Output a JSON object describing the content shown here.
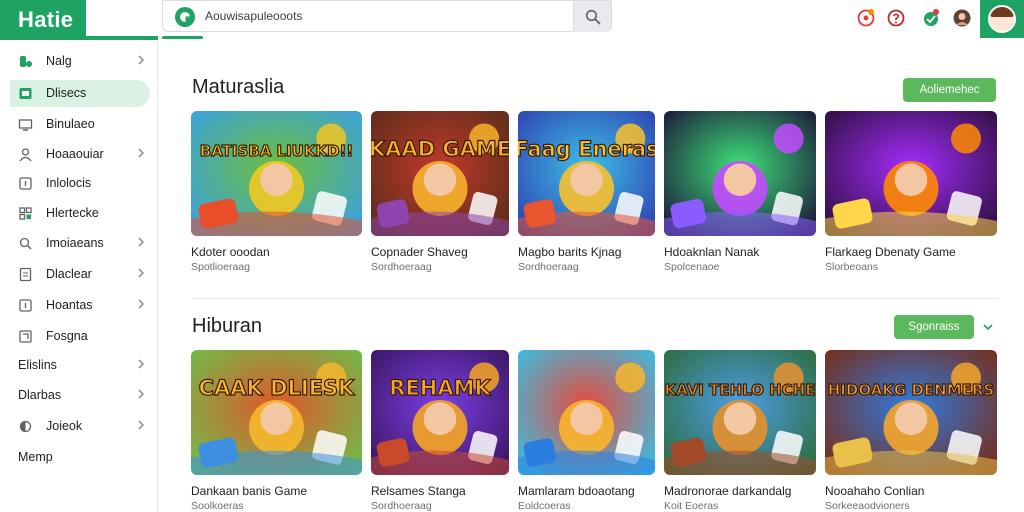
{
  "app": {
    "brand": "Hatie",
    "search_query": "Aouwisapuleooots",
    "search_progress_pct": 9
  },
  "top_icons": [
    "notification-icon",
    "help-icon",
    "gift-icon",
    "settings-avatar-icon"
  ],
  "sidebar": {
    "items": [
      {
        "label": "Nalg",
        "icon": "game-controller-icon",
        "chevron": true,
        "active": false
      },
      {
        "label": "Dlisecs",
        "icon": "window-icon",
        "chevron": false,
        "active": true
      },
      {
        "label": "Binulaeo",
        "icon": "monitor-icon",
        "chevron": false,
        "active": false
      },
      {
        "label": "Hoaaouiar",
        "icon": "user-icon",
        "chevron": true,
        "active": false
      },
      {
        "label": "Inlolocis",
        "icon": "square-icon",
        "chevron": false,
        "active": false
      },
      {
        "label": "Hlertecke",
        "icon": "grid-icon",
        "chevron": false,
        "active": false
      },
      {
        "label": "Imoiaeans",
        "icon": "search-icon",
        "chevron": true,
        "active": false
      },
      {
        "label": "Dlaclear",
        "icon": "document-icon",
        "chevron": true,
        "active": false
      },
      {
        "label": "Hoantas",
        "icon": "square-icon",
        "chevron": true,
        "active": false
      },
      {
        "label": "Fosgna",
        "icon": "box-icon",
        "chevron": false,
        "active": false
      },
      {
        "label": "Elislins",
        "icon": "",
        "chevron": true,
        "active": false
      },
      {
        "label": "Dlarbas",
        "icon": "",
        "chevron": true,
        "active": false
      },
      {
        "label": "Joieok",
        "icon": "circle-icon",
        "chevron": true,
        "active": false
      },
      {
        "label": "Memp",
        "icon": "",
        "chevron": false,
        "active": false
      }
    ]
  },
  "sections": [
    {
      "title": "Maturaslia",
      "button_label": "Aoliemehec",
      "has_dropdown": false,
      "cards": [
        {
          "art_text": "BATISBA LIUKKD!!",
          "title": "Kdoter ooodan",
          "subtitle": "Spotlioeraag"
        },
        {
          "art_text": "KAAD GAME",
          "title": "Copnader Shaveg",
          "subtitle": "Sordhoeraag"
        },
        {
          "art_text": "Faag Eneras",
          "title": "Magbo barits Kjnag",
          "subtitle": "Sordhoeraag"
        },
        {
          "art_text": "",
          "title": "Hdoaknlan Nanak",
          "subtitle": "Spolcenaoe"
        },
        {
          "art_text": "",
          "title": "Flarkaeg Dbenaty Game",
          "subtitle": "Slorbeoans"
        }
      ]
    },
    {
      "title": "Hiburan",
      "button_label": "Sgonraiss",
      "has_dropdown": true,
      "cards": [
        {
          "art_text": "CAAK DLIESK",
          "title": "Dankaan banis Game",
          "subtitle": "Soolkoeras"
        },
        {
          "art_text": "REHAMK",
          "title": "Relsames Stanga",
          "subtitle": "Sordhoeraag"
        },
        {
          "art_text": "",
          "title": "Mamlaram bdoaotang",
          "subtitle": "Eoldcoeras"
        },
        {
          "art_text": "KAVI TEHLO HCHE",
          "title": "Madronorae darkandalg",
          "subtitle": "Koit Eoeras"
        },
        {
          "art_text": "HIDOAKG DENMERS",
          "title": "Nooahaho Conlian",
          "subtitle": "Sorkeeaodvioners"
        }
      ]
    }
  ],
  "colors": {
    "brand_green": "#1ea362",
    "active_bg": "#d9f2e3",
    "button_green": "#5cb85c"
  }
}
